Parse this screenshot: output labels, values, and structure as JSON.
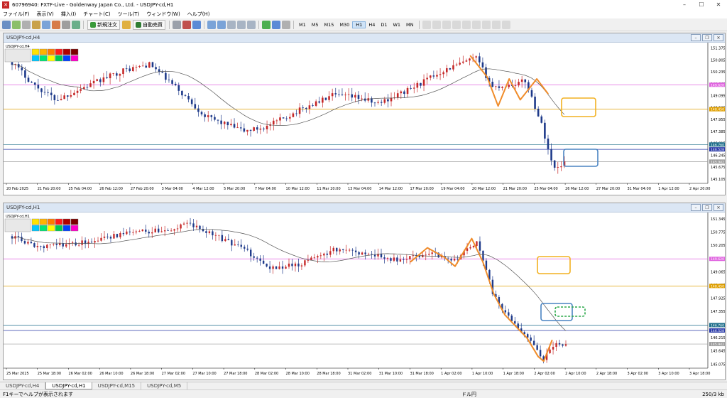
{
  "window": {
    "title": "60796940: FXTF-Live - Goldenway Japan Co., Ltd. - USDJPY-cd,H1",
    "icon": "app-logo-icon"
  },
  "menu": [
    "ファイル(F)",
    "表示(V)",
    "挿入(I)",
    "チャート(C)",
    "ツール(T)",
    "ウィンドウ(W)",
    "ヘルプ(H)"
  ],
  "toolbar": {
    "new_order": "新規注文",
    "auto_trade": "自動売買",
    "timeframes": [
      "M1",
      "M5",
      "M15",
      "M30",
      "H1",
      "H4",
      "D1",
      "W1",
      "MN"
    ],
    "active_timeframe": "H1"
  },
  "colors": {
    "bull": "#c62828",
    "bear": "#1e3a8a",
    "ma": "#555555",
    "pivot": "#e0a000",
    "resist": "#e066e0",
    "support_blue": "#2a3aa8",
    "support_teal": "#1f6f8b",
    "gray": "#9e9e9e",
    "annot_orange": "#f08c2a",
    "box_yellow": "#f2b120",
    "box_blue": "#4a84c2",
    "box_green": "#2ba84a"
  },
  "chart_h4": {
    "caption": "USDJPY-cd,H4",
    "symbol_label": "USDJPY-cd,H4",
    "price_labels": [
      "151.375",
      "150.805",
      "150.235",
      "149.665",
      "149.095",
      "148.525",
      "147.955",
      "147.385",
      "146.815",
      "146.245",
      "145.675",
      "145.105"
    ],
    "level_tags": [
      "149.620",
      "148.450",
      "146.760",
      "146.528",
      "145.942"
    ],
    "time_labels": [
      "20 Feb 2025",
      "21 Feb 20:00",
      "25 Feb 04:00",
      "26 Feb 12:00",
      "27 Feb 20:00",
      "3 Mar 04:00",
      "4 Mar 12:00",
      "5 Mar 20:00",
      "7 Mar 04:00",
      "10 Mar 12:00",
      "11 Mar 20:00",
      "13 Mar 04:00",
      "14 Mar 12:00",
      "17 Mar 20:00",
      "19 Mar 04:00",
      "20 Mar 12:00",
      "21 Mar 20:00",
      "25 Mar 04:00",
      "26 Mar 12:00",
      "27 Mar 20:00",
      "31 Mar 04:00",
      "1 Apr 12:00",
      "2 Apr 20:00"
    ]
  },
  "chart_h1": {
    "caption": "USDJPY-cd,H1",
    "symbol_label": "USDJPY-cd,H1",
    "price_labels": [
      "151.345",
      "150.775",
      "150.205",
      "149.635",
      "149.065",
      "148.495",
      "147.925",
      "147.355",
      "146.785",
      "146.215",
      "145.645",
      "145.075"
    ],
    "level_tags": [
      "149.620",
      "148.450",
      "146.760",
      "146.528",
      "145.942"
    ],
    "time_labels": [
      "25 Mar 2025",
      "25 Mar 18:00",
      "26 Mar 02:00",
      "26 Mar 10:00",
      "26 Mar 18:00",
      "27 Mar 02:00",
      "27 Mar 10:00",
      "27 Mar 18:00",
      "28 Mar 02:00",
      "28 Mar 10:00",
      "28 Mar 18:00",
      "31 Mar 02:00",
      "31 Mar 10:00",
      "31 Mar 18:00",
      "1 Apr 02:00",
      "1 Apr 10:00",
      "1 Apr 18:00",
      "2 Apr 02:00",
      "2 Apr 10:00",
      "2 Apr 18:00",
      "3 Apr 02:00",
      "3 Apr 10:00",
      "3 Apr 18:00"
    ]
  },
  "tabs": [
    "USDJPY-cd,H4",
    "USDJPY-cd,H1",
    "USDJPY-cd,M15",
    "USDJPY-cd,M5"
  ],
  "active_tab": "USDJPY-cd,H1",
  "status": {
    "help": "F1キーでヘルプが表示されます",
    "instrument": "ドル円",
    "traffic": "250/3 kb"
  }
}
